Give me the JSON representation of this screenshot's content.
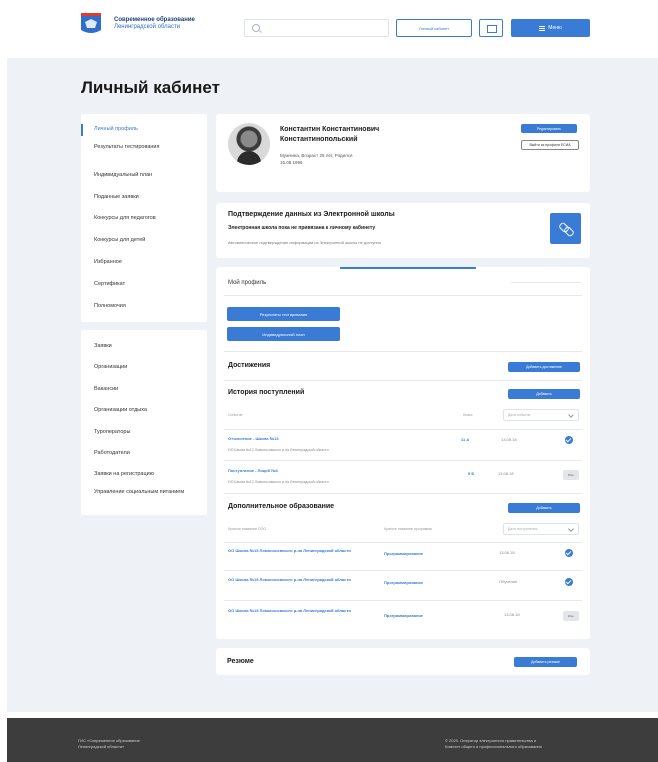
{
  "header": {
    "brand_line1": "Современное образование",
    "brand_line2": "Ленинградской области",
    "search_placeholder": "",
    "cabinet_button": "Личный кабинет",
    "menu_button": "Меню"
  },
  "page": {
    "title": "Личный кабинет"
  },
  "sidebar": {
    "group1": [
      "Личный профиль",
      "Результаты тестирования",
      "Индивидуальный план",
      "Поданные заявки",
      "Конкурсы для педагогов",
      "Конкурсы для детей",
      "Избранное",
      "Сертификат",
      "Полномочия"
    ],
    "group2": [
      "Заявки",
      "Организации",
      "Вакансии",
      "Организации отдыха",
      "Туроператоры",
      "Работодатели",
      "Заявки на регистрацию",
      "Управление социальным питанием"
    ]
  },
  "profile": {
    "name": "Константин Константинович Константинопольский",
    "info_line1": "Мужчина, Возраст 25 лет, Родился",
    "info_line2": "15.08.1996",
    "edit_button": "Редактировать",
    "logout_button": "Выйти из профиля ЕСИА"
  },
  "school": {
    "title": "Подтверждение данных из Электронной школы",
    "subtitle": "Электронная школа пока не привязана к личному кабинету",
    "note": "Автоматическое подтверждение информации из Электронной школы не доступно"
  },
  "main": {
    "tab_label": "Мой профиль",
    "btn_results": "Результаты тестирования",
    "btn_plan": "Индивидуальный план",
    "achievements": {
      "title": "Достижения",
      "button": "Добавить достижение"
    },
    "history": {
      "title": "История поступлений",
      "button": "Добавить",
      "col_event": "Событие",
      "col_class": "Класс",
      "filter": "Дата события",
      "rows": [
        {
          "title": "Отчисление - Школа №13",
          "sub": "ОО Школа №13 Ломоносовского р-на Ленинградской области",
          "class": "11 А",
          "date": "13.08.18",
          "status": "ok"
        },
        {
          "title": "Поступление - Лицей №4",
          "sub": "ОО Школа №13 Ломоносовского р-на Ленинградской области",
          "class": "5 Б",
          "date": "13.08.18",
          "status": "edit"
        }
      ]
    },
    "additional": {
      "title": "Дополнительное образование",
      "button": "Добавить",
      "col_org": "Краткое название ООО",
      "col_prog": "Краткое название программы",
      "filter": "Дата поступления",
      "rows": [
        {
          "title": "ОО Школа №15 Ломоносовского р-на Ленинградской области",
          "prog": "Программирование",
          "status_text": "13.08.18",
          "status": "ok"
        },
        {
          "title": "ОО Школа №15 Ломоносовского р-на Ленинградской области",
          "prog": "Программирование",
          "status_text": "Обучение",
          "status": "ok"
        },
        {
          "title": "ОО Школа №15 Ломоносовского р-на Ленинградской области",
          "prog": "Программирование",
          "status_text": "13.08.18",
          "status": "edit"
        }
      ]
    },
    "edit_tag": "Изм."
  },
  "resume": {
    "title": "Резюме",
    "button": "Добавить резюме"
  },
  "footer": {
    "left_line1": "ГИС «Современное образование",
    "left_line2": "Ленинградской области»",
    "right_line1": "© 2020. Оператор электронного правительства и",
    "right_line2": "Комитет общего и профессионального образования"
  }
}
